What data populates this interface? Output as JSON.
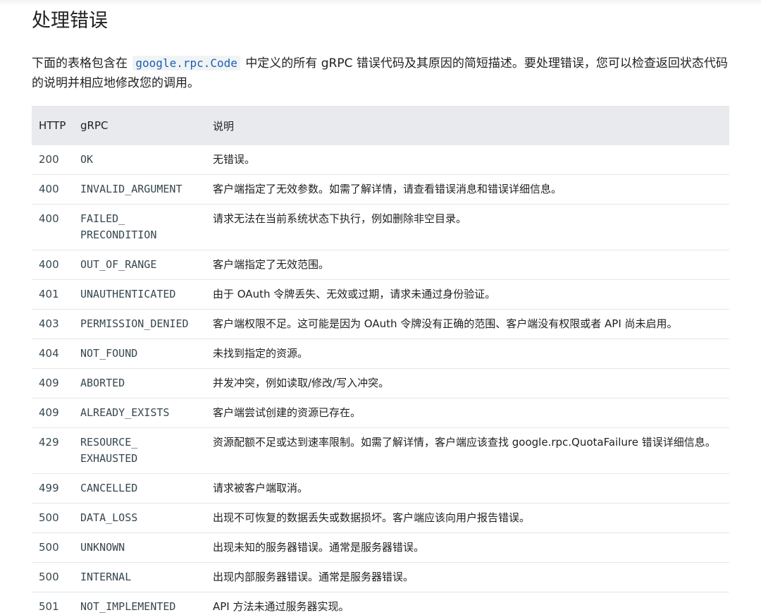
{
  "title": "处理错误",
  "intro": {
    "before": "下面的表格包含在",
    "code": "google.rpc.Code",
    "after": "中定义的所有 gRPC 错误代码及其原因的简短描述。要处理错误，您可以检查返回状态代码的说明并相应地修改您的调用。"
  },
  "table": {
    "headers": [
      "HTTP",
      "gRPC",
      "说明"
    ],
    "rows": [
      {
        "http": "200",
        "grpc": "OK",
        "desc": "无错误。"
      },
      {
        "http": "400",
        "grpc": "INVALID_ARGUMENT",
        "desc": "客户端指定了无效参数。如需了解详情，请查看错误消息和错误详细信息。"
      },
      {
        "http": "400",
        "grpc": "FAILED_\nPRECONDITION",
        "desc": "请求无法在当前系统状态下执行，例如删除非空目录。"
      },
      {
        "http": "400",
        "grpc": "OUT_OF_RANGE",
        "desc": "客户端指定了无效范围。"
      },
      {
        "http": "401",
        "grpc": "UNAUTHENTICATED",
        "desc": "由于 OAuth 令牌丢失、无效或过期，请求未通过身份验证。"
      },
      {
        "http": "403",
        "grpc": "PERMISSION_DENIED",
        "desc": "客户端权限不足。这可能是因为 OAuth 令牌没有正确的范围、客户端没有权限或者 API 尚未启用。"
      },
      {
        "http": "404",
        "grpc": "NOT_FOUND",
        "desc": "未找到指定的资源。"
      },
      {
        "http": "409",
        "grpc": "ABORTED",
        "desc": "并发冲突，例如读取/修改/写入冲突。"
      },
      {
        "http": "409",
        "grpc": "ALREADY_EXISTS",
        "desc": "客户端尝试创建的资源已存在。"
      },
      {
        "http": "429",
        "grpc": "RESOURCE_\nEXHAUSTED",
        "desc": "资源配额不足或达到速率限制。如需了解详情，客户端应该查找 google.rpc.QuotaFailure 错误详细信息。"
      },
      {
        "http": "499",
        "grpc": "CANCELLED",
        "desc": "请求被客户端取消。"
      },
      {
        "http": "500",
        "grpc": "DATA_LOSS",
        "desc": "出现不可恢复的数据丢失或数据损坏。客户端应该向用户报告错误。"
      },
      {
        "http": "500",
        "grpc": "UNKNOWN",
        "desc": "出现未知的服务器错误。通常是服务器错误。"
      },
      {
        "http": "500",
        "grpc": "INTERNAL",
        "desc": "出现内部服务器错误。通常是服务器错误。"
      },
      {
        "http": "501",
        "grpc": "NOT_IMPLEMENTED",
        "desc": "API 方法未通过服务器实现。"
      }
    ]
  }
}
